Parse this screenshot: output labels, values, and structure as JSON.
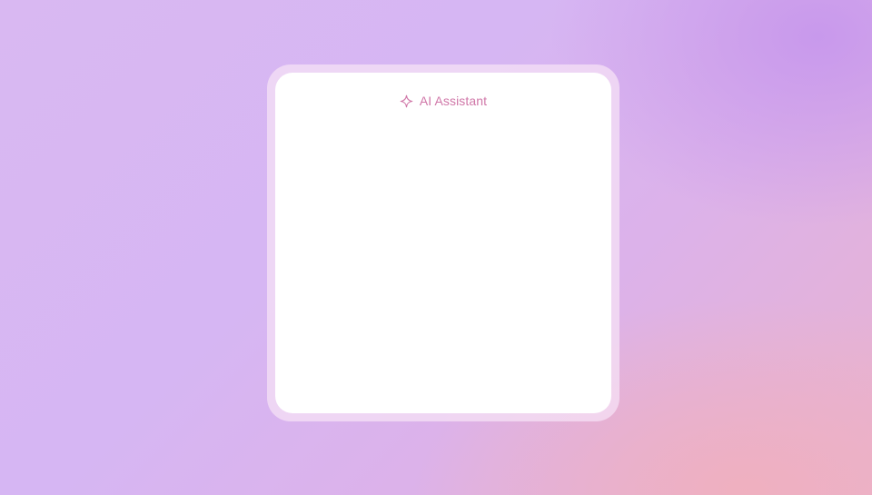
{
  "assistant": {
    "title": "AI Assistant",
    "icon": "sparkle-icon",
    "accent_color": "#d077a8"
  }
}
